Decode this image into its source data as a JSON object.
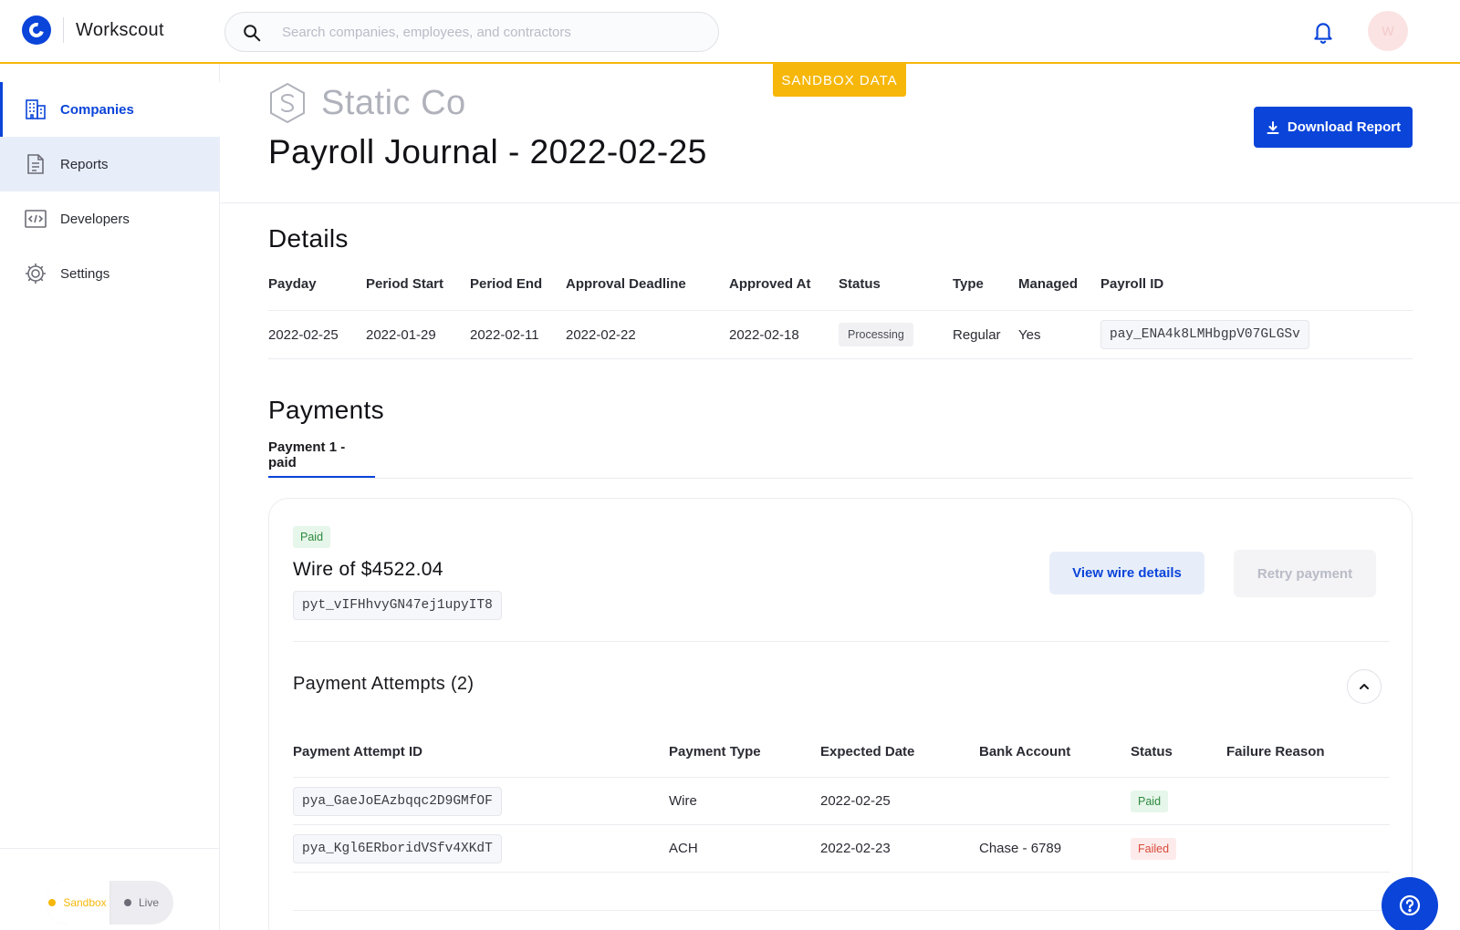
{
  "app": {
    "name": "Workscout"
  },
  "search": {
    "placeholder": "Search companies, employees, and contractors"
  },
  "user": {
    "initial": "W"
  },
  "sidebar": {
    "items": [
      {
        "label": "Companies",
        "icon": "building-icon"
      },
      {
        "label": "Reports",
        "icon": "document-icon"
      },
      {
        "label": "Developers",
        "icon": "code-icon"
      },
      {
        "label": "Settings",
        "icon": "gear-icon"
      }
    ],
    "env": {
      "sandbox": "Sandbox",
      "live": "Live"
    }
  },
  "banner": {
    "sandbox": "SANDBOX DATA"
  },
  "header": {
    "company": "Static Co",
    "title": "Payroll Journal - 2022-02-25",
    "download_label": "Download Report"
  },
  "details": {
    "title": "Details",
    "columns": [
      "Payday",
      "Period Start",
      "Period End",
      "Approval Deadline",
      "Approved At",
      "Status",
      "Type",
      "Managed",
      "Payroll ID"
    ],
    "row": {
      "payday": "2022-02-25",
      "period_start": "2022-01-29",
      "period_end": "2022-02-11",
      "approval_deadline": "2022-02-22",
      "approved_at": "2022-02-18",
      "status": "Processing",
      "type": "Regular",
      "managed": "Yes",
      "payroll_id": "pay_ENA4k8LMHbgpV07GLGSv"
    }
  },
  "payments": {
    "title": "Payments",
    "tab_label": "Payment 1 - paid",
    "card": {
      "status": "Paid",
      "title": "Wire of $4522.04",
      "payment_id": "pyt_vIFHhvyGN47ej1upyIT8",
      "view_label": "View wire details",
      "retry_label": "Retry payment"
    },
    "attempts": {
      "title": "Payment Attempts (2)",
      "columns": [
        "Payment Attempt ID",
        "Payment Type",
        "Expected Date",
        "Bank Account",
        "Status",
        "Failure Reason"
      ],
      "rows": [
        {
          "id": "pya_GaeJoEAzbqqc2D9GMfOF",
          "type": "Wire",
          "expected": "2022-02-25",
          "bank": "",
          "status": "Paid",
          "failure": ""
        },
        {
          "id": "pya_Kgl6ERboridVSfv4XKdT",
          "type": "ACH",
          "expected": "2022-02-23",
          "bank": "Chase - 6789",
          "status": "Failed",
          "failure": ""
        }
      ]
    }
  },
  "colors": {
    "accent": "#0a44d9",
    "sandbox": "#f6b70a",
    "paid": "#2e8a3e",
    "failed": "#d84a3a"
  }
}
